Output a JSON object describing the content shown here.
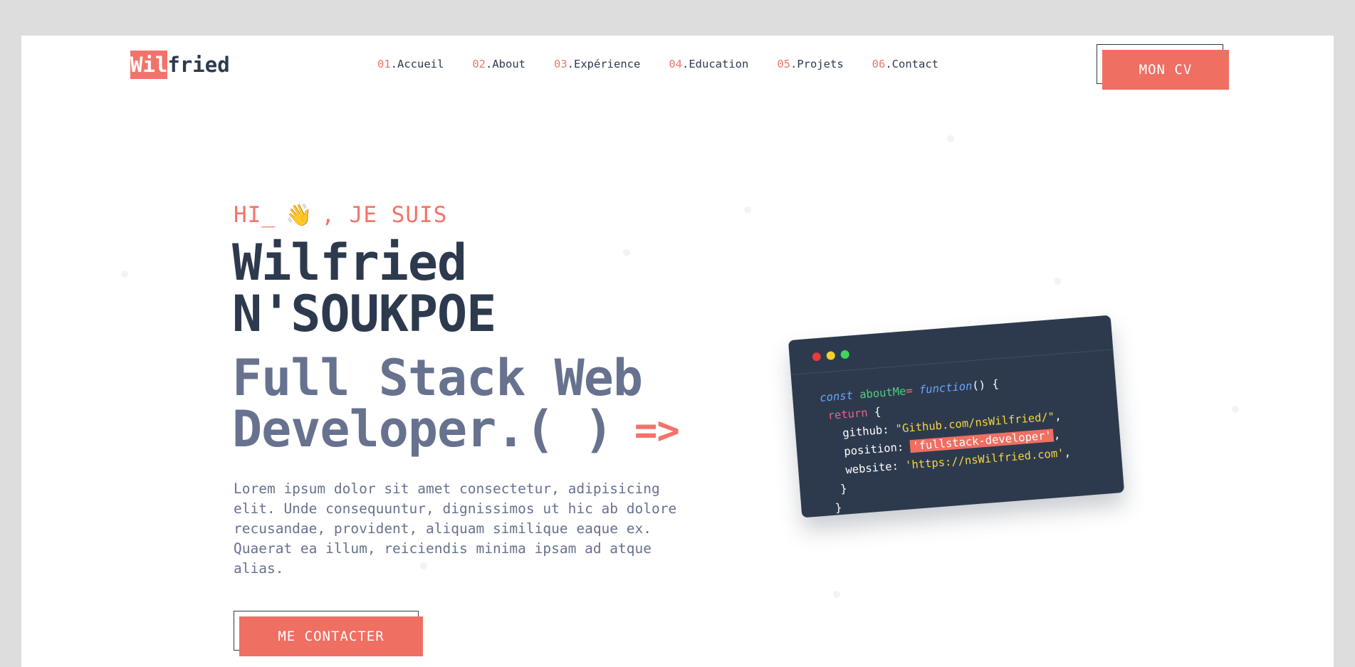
{
  "header": {
    "logo_highlight": "Wil",
    "logo_rest": "fried",
    "nav": [
      {
        "num": "01",
        "label": ".Accueil"
      },
      {
        "num": "02",
        "label": ".About"
      },
      {
        "num": "03",
        "label": ".Expérience"
      },
      {
        "num": "04",
        "label": ".Education"
      },
      {
        "num": "05",
        "label": ".Projets"
      },
      {
        "num": "06",
        "label": ".Contact"
      }
    ],
    "cv_button": "MON CV"
  },
  "hero": {
    "greeting_prefix": "HI_",
    "wave_emoji": "👋",
    "greeting_suffix": ", JE SUIS",
    "name_line1": "Wilfried",
    "name_line2": "N'SOUKPOE",
    "role_line1": "Full Stack Web",
    "role_line2": "Developer.( )",
    "role_arrow": "=>",
    "description": "Lorem ipsum dolor sit amet consectetur, adipisicing elit. Unde consequuntur, dignissimos ut hic ab dolore recusandae, provident, aliquam similique eaque ex. Quaerat ea illum, reiciendis minima ipsam ad atque alias.",
    "contact_button": "ME CONTACTER"
  },
  "code_card": {
    "kw_const": "const",
    "var_name": "aboutMe",
    "eq": "=",
    "kw_function": "function",
    "fn_open": "() {",
    "kw_return": "return",
    "ret_open": " {",
    "github_key": "github: ",
    "github_val": "\"Github.com/nsWilfried/\"",
    "position_key": "position: ",
    "position_val": "'fullstack-developer'",
    "website_key": "website: ",
    "website_val": "'https://nsWilfried.com'",
    "comma": ",",
    "close_inner": "}",
    "close_outer": "}"
  },
  "colors": {
    "accent": "#ef6f62",
    "navy": "#2d3a4e",
    "slate": "#67728f"
  }
}
